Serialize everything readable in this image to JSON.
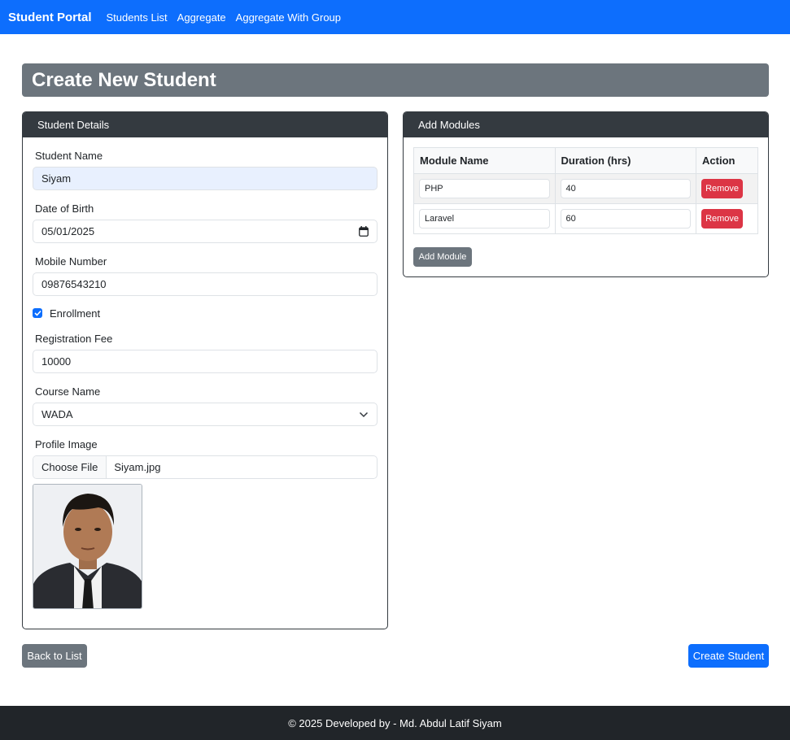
{
  "nav": {
    "brand": "Student Portal",
    "links": [
      "Students List",
      "Aggregate",
      "Aggregate With Group"
    ]
  },
  "page_title": "Create New Student",
  "student_details": {
    "header": "Student Details",
    "name_label": "Student Name",
    "name_value": "Siyam",
    "dob_label": "Date of Birth",
    "dob_value": "05/01/2025",
    "mobile_label": "Mobile Number",
    "mobile_value": "09876543210",
    "enrollment_label": "Enrollment",
    "enrollment_checked": true,
    "fee_label": "Registration Fee",
    "fee_value": "10000",
    "course_label": "Course Name",
    "course_value": "WADA",
    "image_label": "Profile Image",
    "choose_file": "Choose File",
    "file_name": "Siyam.jpg"
  },
  "modules": {
    "header": "Add Modules",
    "columns": [
      "Module Name",
      "Duration (hrs)",
      "Action"
    ],
    "rows": [
      {
        "name": "PHP",
        "duration": "40",
        "action": "Remove"
      },
      {
        "name": "Laravel",
        "duration": "60",
        "action": "Remove"
      }
    ],
    "add_button": "Add Module"
  },
  "buttons": {
    "back": "Back to List",
    "create": "Create Student"
  },
  "footer": "© 2025 Developed by - Md. Abdul Latif Siyam",
  "colors": {
    "primary": "#0d6efd",
    "secondary": "#6c757d",
    "dark": "#343a40",
    "danger": "#dc3545",
    "footer": "#212529"
  }
}
